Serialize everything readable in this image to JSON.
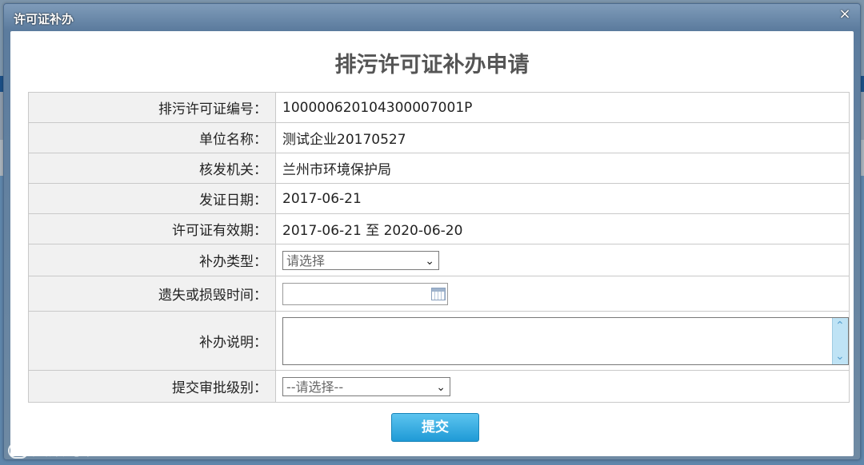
{
  "dialog": {
    "title": "许可证补办",
    "close": "×"
  },
  "form": {
    "title": "排污许可证补办申请",
    "rows": [
      {
        "label": "排污许可证编号：",
        "value": "100000620104300007001P"
      },
      {
        "label": "单位名称：",
        "value": "测试企业20170527"
      },
      {
        "label": "核发机关：",
        "value": "兰州市环境保护局"
      },
      {
        "label": "发证日期：",
        "value": "2017-06-21"
      },
      {
        "label": "许可证有效期：",
        "value": "2017-06-21 至 2020-06-20"
      }
    ],
    "reissue_type": {
      "label": "补办类型：",
      "selected": "请选择"
    },
    "loss_time": {
      "label": "遗失或损毁时间：",
      "value": ""
    },
    "description": {
      "label": "补办说明：",
      "value": ""
    },
    "approval_level": {
      "label": "提交审批级别：",
      "selected": "--请选择--"
    },
    "submit_label": "提交"
  },
  "watermark": {
    "text": "大数跨境"
  },
  "icons": {
    "close": "close-icon",
    "dropdown": "chevron-down-icon",
    "calendar": "calendar-icon",
    "scroll_up": "chevron-up-icon",
    "scroll_down": "chevron-down-icon"
  },
  "colors": {
    "submit": "#1f9ad6",
    "label_bg": "#f1f1f1",
    "titlebar": "#5c7c9e"
  }
}
